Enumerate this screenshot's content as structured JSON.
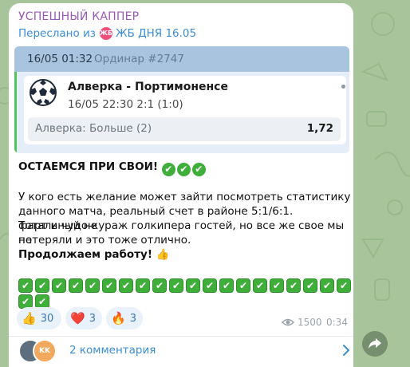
{
  "message": {
    "sender": "УСПЕШНЫЙ КАППЕР",
    "forwarded_prefix": "Переслано из",
    "forwarded_avatar_text": "ЖБ",
    "forwarded_channel": "ЖБ ДНЯ 16.05",
    "bet_card": {
      "datetime": "16/05 01:32",
      "type": "Ординар #2747",
      "match_name": "Алверка - Портимоненсе",
      "match_result": "16/05 22:30 2:1 (1:0)",
      "bet": "Алверка: Больше (2)",
      "odds": "1,72"
    },
    "headline": "ОСТАЕМСЯ ПРИ СВОИ!",
    "headline_checks": [
      "✔",
      "✔",
      "✔"
    ],
    "body_lines": [
      "У кого есть желание может зайти посмотреть статистику",
      "данного матча, реальный счет в районе 5:1/6:1. Тотальный не",
      "фарт и чудо-кураж голкипера гостей, но все же свое мы не",
      "потеряли и это тоже отлично."
    ],
    "closing": "Продолжаем работу!",
    "closing_emoji": "👍",
    "check_rows": [
      [
        "✔",
        "✔",
        "✔",
        "✔",
        "✔",
        "✔",
        "✔",
        "✔",
        "✔",
        "✔",
        "✔",
        "✔",
        "✔",
        "✔",
        "✔",
        "✔",
        "✔",
        "✔",
        "✔",
        "✔"
      ],
      [
        "✔",
        "✔"
      ]
    ],
    "reactions": [
      {
        "emoji": "👍",
        "count": "30"
      },
      {
        "emoji": "❤️",
        "count": "3"
      },
      {
        "emoji": "🔥",
        "count": "3"
      }
    ],
    "views": "1500",
    "time": "0:34",
    "comments_label": "2 комментария",
    "comments_avatar_text": "KK"
  },
  "colors": {
    "background": "#a7c49a",
    "sender": "#9b59b6",
    "link": "#3a8ed8",
    "accent_green": "#4ec45a",
    "card_header": "#a9c4df"
  }
}
